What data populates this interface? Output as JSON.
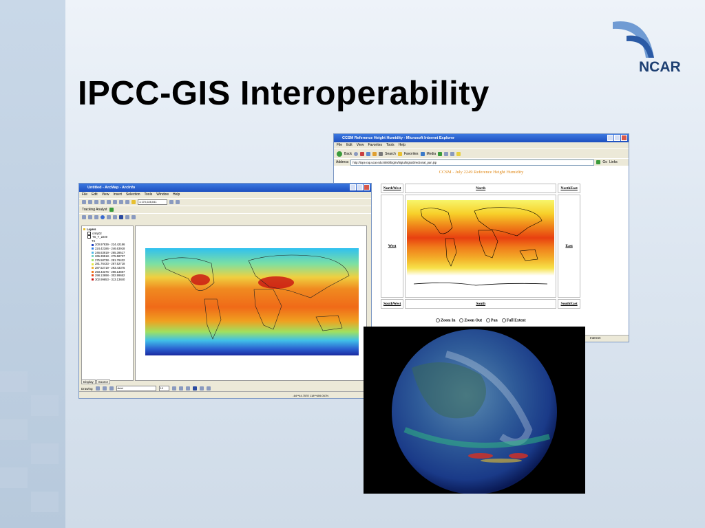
{
  "slide": {
    "title": "IPCC-GIS Interoperability",
    "logo_text": "NCAR"
  },
  "arcmap": {
    "title": "Untitled - ArcMap - ArcInfo",
    "menu": [
      "File",
      "Edit",
      "View",
      "Insert",
      "Selection",
      "Tools",
      "Window",
      "Help"
    ],
    "scale": "1:170,028,041",
    "tracking_label": "Tracking Analyst",
    "toc": {
      "root": "Layers",
      "layer1": "cntry02",
      "layer2": "TS_T_2249",
      "field": "TS",
      "legend": [
        {
          "label": "200.97939 - 224.42186",
          "color": "#1f3fbf"
        },
        {
          "label": "224.42186 - 246.63918",
          "color": "#2f7fe8"
        },
        {
          "label": "246.63919 - 265.39517",
          "color": "#4fb7e8"
        },
        {
          "label": "265.39518 - 275.58737",
          "color": "#6fd3c8"
        },
        {
          "label": "275.58738 - 281.76432",
          "color": "#9fe06f"
        },
        {
          "label": "281.76433 - 287.52718",
          "color": "#e6e63f"
        },
        {
          "label": "287.52719 - 293.43375",
          "color": "#f0b030"
        },
        {
          "label": "293.43376 - 298.13697",
          "color": "#f07a20"
        },
        {
          "label": "298.13698 - 302.99652",
          "color": "#e84a18"
        },
        {
          "label": "302.99653 - 313.13840",
          "color": "#c81010"
        }
      ],
      "tabs": [
        "Display",
        "Source"
      ]
    },
    "drawing_label": "Drawing",
    "font_name": "Arial",
    "font_size": "10",
    "coords": "-64**44.757E 118**659.057N"
  },
  "ie": {
    "title": "CCSM Reference Height Humidity - Microsoft Internet Explorer",
    "menu": [
      "File",
      "Edit",
      "View",
      "Favorites",
      "Tools",
      "Help"
    ],
    "toolbar": {
      "back": "Back",
      "search": "Search",
      "favorites": "Favorites",
      "media": "Media"
    },
    "address_label": "Address",
    "address": "http://tope.rap.ucar.edu:8080/bigtrn/bigtu/bigtu/directional_pan.jsp",
    "go_label": "Go",
    "links_label": "Links",
    "heading": "CCSM - July 2249 Reference Height Humidity",
    "nav": {
      "northwest": "NorthWest",
      "north": "North",
      "northeast": "NorthEast",
      "west": "West",
      "east": "East",
      "southwest": "SouthWest",
      "south": "South",
      "southeast": "SouthEast"
    },
    "radios": [
      "Zoom In",
      "Zoom Out",
      "Pan",
      "Full Extent"
    ],
    "status": "Internet"
  }
}
